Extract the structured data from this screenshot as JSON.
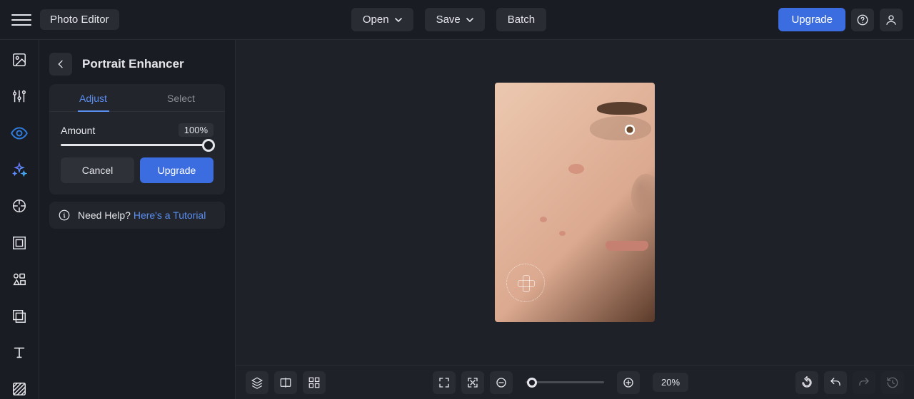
{
  "topbar": {
    "app_title": "Photo Editor",
    "open_label": "Open",
    "save_label": "Save",
    "batch_label": "Batch",
    "upgrade_label": "Upgrade"
  },
  "rail": {
    "items": [
      {
        "name": "image-icon"
      },
      {
        "name": "adjust-icon"
      },
      {
        "name": "eye-icon",
        "active": true
      },
      {
        "name": "sparkle-icon",
        "gradient": true
      },
      {
        "name": "sticker-icon"
      },
      {
        "name": "frame-icon"
      },
      {
        "name": "shapes-icon"
      },
      {
        "name": "overlay-icon"
      },
      {
        "name": "text-icon"
      },
      {
        "name": "texture-icon"
      }
    ]
  },
  "panel": {
    "title": "Portrait Enhancer",
    "tabs": {
      "adjust": "Adjust",
      "select": "Select"
    },
    "amount_label": "Amount",
    "amount_value": "100%",
    "cancel_label": "Cancel",
    "upgrade_label": "Upgrade"
  },
  "help": {
    "prefix": "Need Help? ",
    "link": "Here's a Tutorial"
  },
  "bottombar": {
    "zoom_pct": "20%"
  }
}
